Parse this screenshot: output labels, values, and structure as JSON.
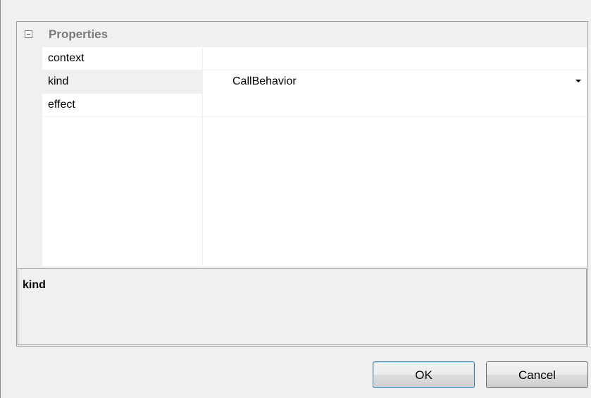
{
  "property_grid": {
    "category": {
      "label": "Properties",
      "expanded": true
    },
    "rows": [
      {
        "name": "context",
        "value": ""
      },
      {
        "name": "kind",
        "value": "CallBehavior",
        "has_dropdown": true,
        "selected": true
      },
      {
        "name": "effect",
        "value": ""
      }
    ]
  },
  "description": {
    "title": "kind",
    "text": ""
  },
  "buttons": {
    "ok_label": "OK",
    "cancel_label": "Cancel"
  },
  "colors": {
    "grid_background": "#f0f0f0",
    "row_background": "#ffffff",
    "category_text": "#7a7a7a",
    "default_button_border": "#3c7fb1"
  }
}
